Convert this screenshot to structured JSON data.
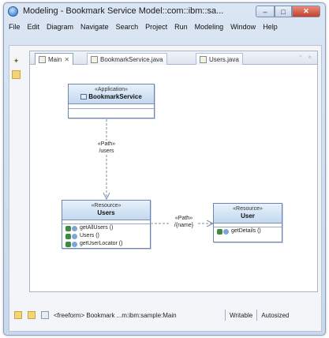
{
  "window": {
    "title": "Modeling - Bookmark Service Model::com::ibm::sa...",
    "controls": {
      "minimize": "–",
      "maximize": "□",
      "close": "✕"
    }
  },
  "menu": [
    "File",
    "Edit",
    "Diagram",
    "Navigate",
    "Search",
    "Project",
    "Run",
    "Modeling",
    "Window",
    "Help"
  ],
  "tabs": [
    {
      "label": "Main",
      "close": "✕",
      "active": true
    },
    {
      "label": "BookmarkService.java",
      "active": false
    },
    {
      "label": "Users.java",
      "active": false
    }
  ],
  "tab_controls": "⁻ ▫",
  "diagram": {
    "classes": {
      "bookmark_service": {
        "stereotype": "«Application»",
        "name": "BookmarkService"
      },
      "users_resource": {
        "stereotype": "«Resource»",
        "name": "Users",
        "operations": [
          "getAllUsers ()",
          "Users ()",
          "getUserLocator ()"
        ]
      },
      "user_resource": {
        "stereotype": "«Resource»",
        "name": "User",
        "operations": [
          "getDetails ()"
        ]
      }
    },
    "links": {
      "service_to_users": {
        "stereotype": "«Path»",
        "value": "/users"
      },
      "users_to_user": {
        "stereotype": "«Path»",
        "value": "/{name}"
      }
    }
  },
  "status": {
    "path": "<freeform> Bookmark ...m:ibm:sample:Main",
    "mode": "Writable",
    "insert": "Autosized"
  },
  "colors": {
    "class_header_top": "#e8f1fb",
    "class_header_bottom": "#c3d8ef",
    "class_border": "#6d86ab",
    "window_frame": "#c9d8ec",
    "close_button": "#c4402a"
  }
}
